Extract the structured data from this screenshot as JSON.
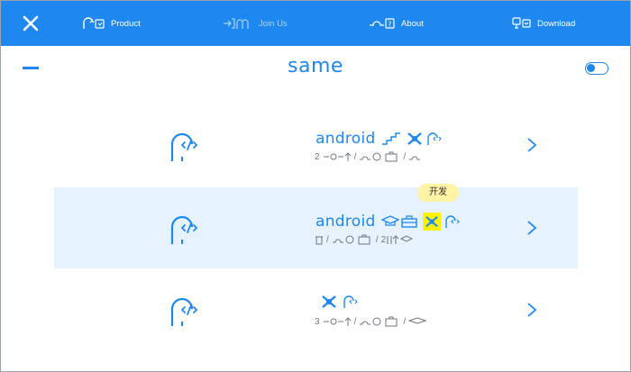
{
  "nav": {
    "items": [
      {
        "label": "Product",
        "icon": "android-code-icon"
      },
      {
        "label": "Join Us",
        "icon": "login-icon"
      },
      {
        "label": "About",
        "icon": "help-icon"
      },
      {
        "label": "Download",
        "icon": "download-icon"
      }
    ]
  },
  "header": {
    "title": "same"
  },
  "rows": [
    {
      "brand": "android",
      "sub_count": "2",
      "sub_count2": "",
      "selected": false
    },
    {
      "brand": "android",
      "sub_count": "",
      "sub_count2": "2",
      "selected": true,
      "tooltip": "开发"
    },
    {
      "brand": "",
      "sub_count": "3",
      "sub_count2": "",
      "selected": false
    }
  ],
  "separators": "/",
  "colors": {
    "accent": "#1e88f0",
    "selected_bg": "#e6f2fd",
    "highlight": "#fff200",
    "tooltip_bg": "#fff3a6"
  }
}
